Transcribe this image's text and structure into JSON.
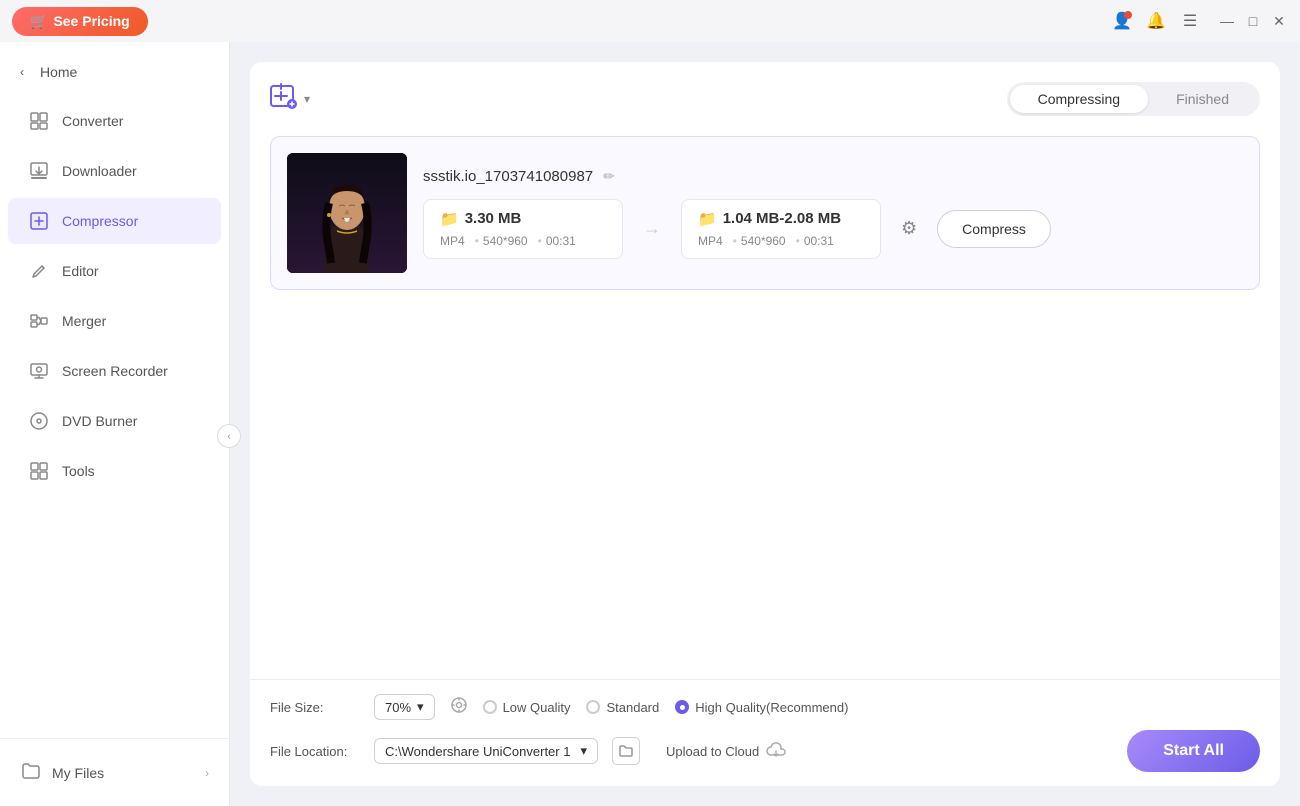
{
  "titlebar": {
    "see_pricing": "See Pricing",
    "pricing_icon": "🛒"
  },
  "sidebar": {
    "home_label": "Home",
    "items": [
      {
        "id": "converter",
        "label": "Converter",
        "icon": "⊡"
      },
      {
        "id": "downloader",
        "label": "Downloader",
        "icon": "⬇"
      },
      {
        "id": "compressor",
        "label": "Compressor",
        "icon": "⊞"
      },
      {
        "id": "editor",
        "label": "Editor",
        "icon": "✂"
      },
      {
        "id": "merger",
        "label": "Merger",
        "icon": "⊟"
      },
      {
        "id": "screen-recorder",
        "label": "Screen Recorder",
        "icon": "⊡"
      },
      {
        "id": "dvd-burner",
        "label": "DVD Burner",
        "icon": "⊡"
      },
      {
        "id": "tools",
        "label": "Tools",
        "icon": "⊞"
      }
    ],
    "my_files_label": "My Files"
  },
  "tabs": {
    "compressing": "Compressing",
    "finished": "Finished"
  },
  "file": {
    "name": "ssstik.io_1703741080987",
    "original_size": "3.30 MB",
    "original_format": "MP4",
    "original_resolution": "540*960",
    "original_duration": "00:31",
    "target_size": "1.04 MB-2.08 MB",
    "target_format": "MP4",
    "target_resolution": "540*960",
    "target_duration": "00:31",
    "compress_btn": "Compress"
  },
  "bottom": {
    "file_size_label": "File Size:",
    "file_size_value": "70%",
    "quality_options": [
      {
        "id": "low",
        "label": "Low Quality"
      },
      {
        "id": "standard",
        "label": "Standard"
      },
      {
        "id": "high",
        "label": "High Quality(Recommend)"
      }
    ],
    "file_location_label": "File Location:",
    "file_location_value": "C:\\Wondershare UniConverter 1",
    "upload_cloud_label": "Upload to Cloud",
    "start_all_btn": "Start All"
  },
  "window_controls": {
    "minimize": "—",
    "maximize": "□",
    "close": "✕"
  }
}
